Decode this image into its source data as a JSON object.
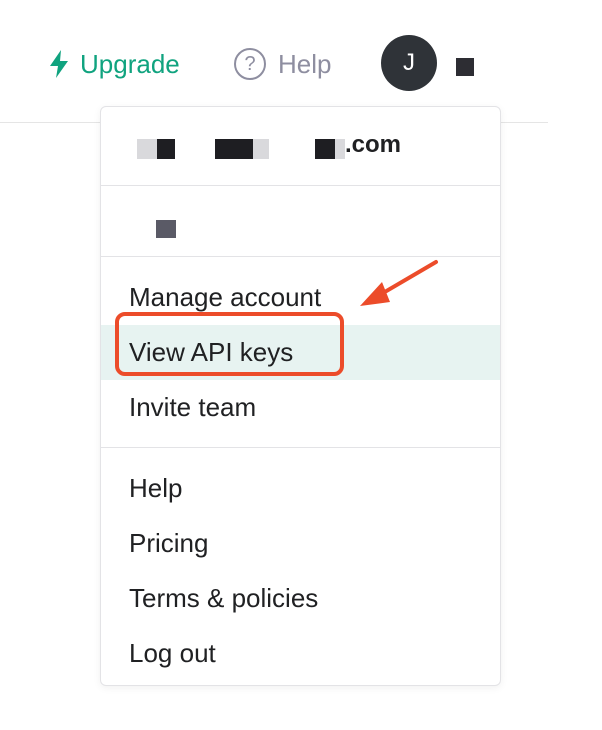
{
  "header": {
    "upgrade_label": "Upgrade",
    "help_label": "Help",
    "help_icon_glyph": "?",
    "avatar_initial": "J"
  },
  "account": {
    "email_visible_suffix": ".com"
  },
  "menu": {
    "group1": [
      "Manage account",
      "View API keys",
      "Invite team"
    ],
    "group2": [
      "Help",
      "Pricing",
      "Terms & policies",
      "Log out"
    ],
    "active_item": "View API keys"
  },
  "colors": {
    "accent": "#10a37f",
    "annotation": "#ec4c2a",
    "active_bg": "#e7f3f1"
  }
}
